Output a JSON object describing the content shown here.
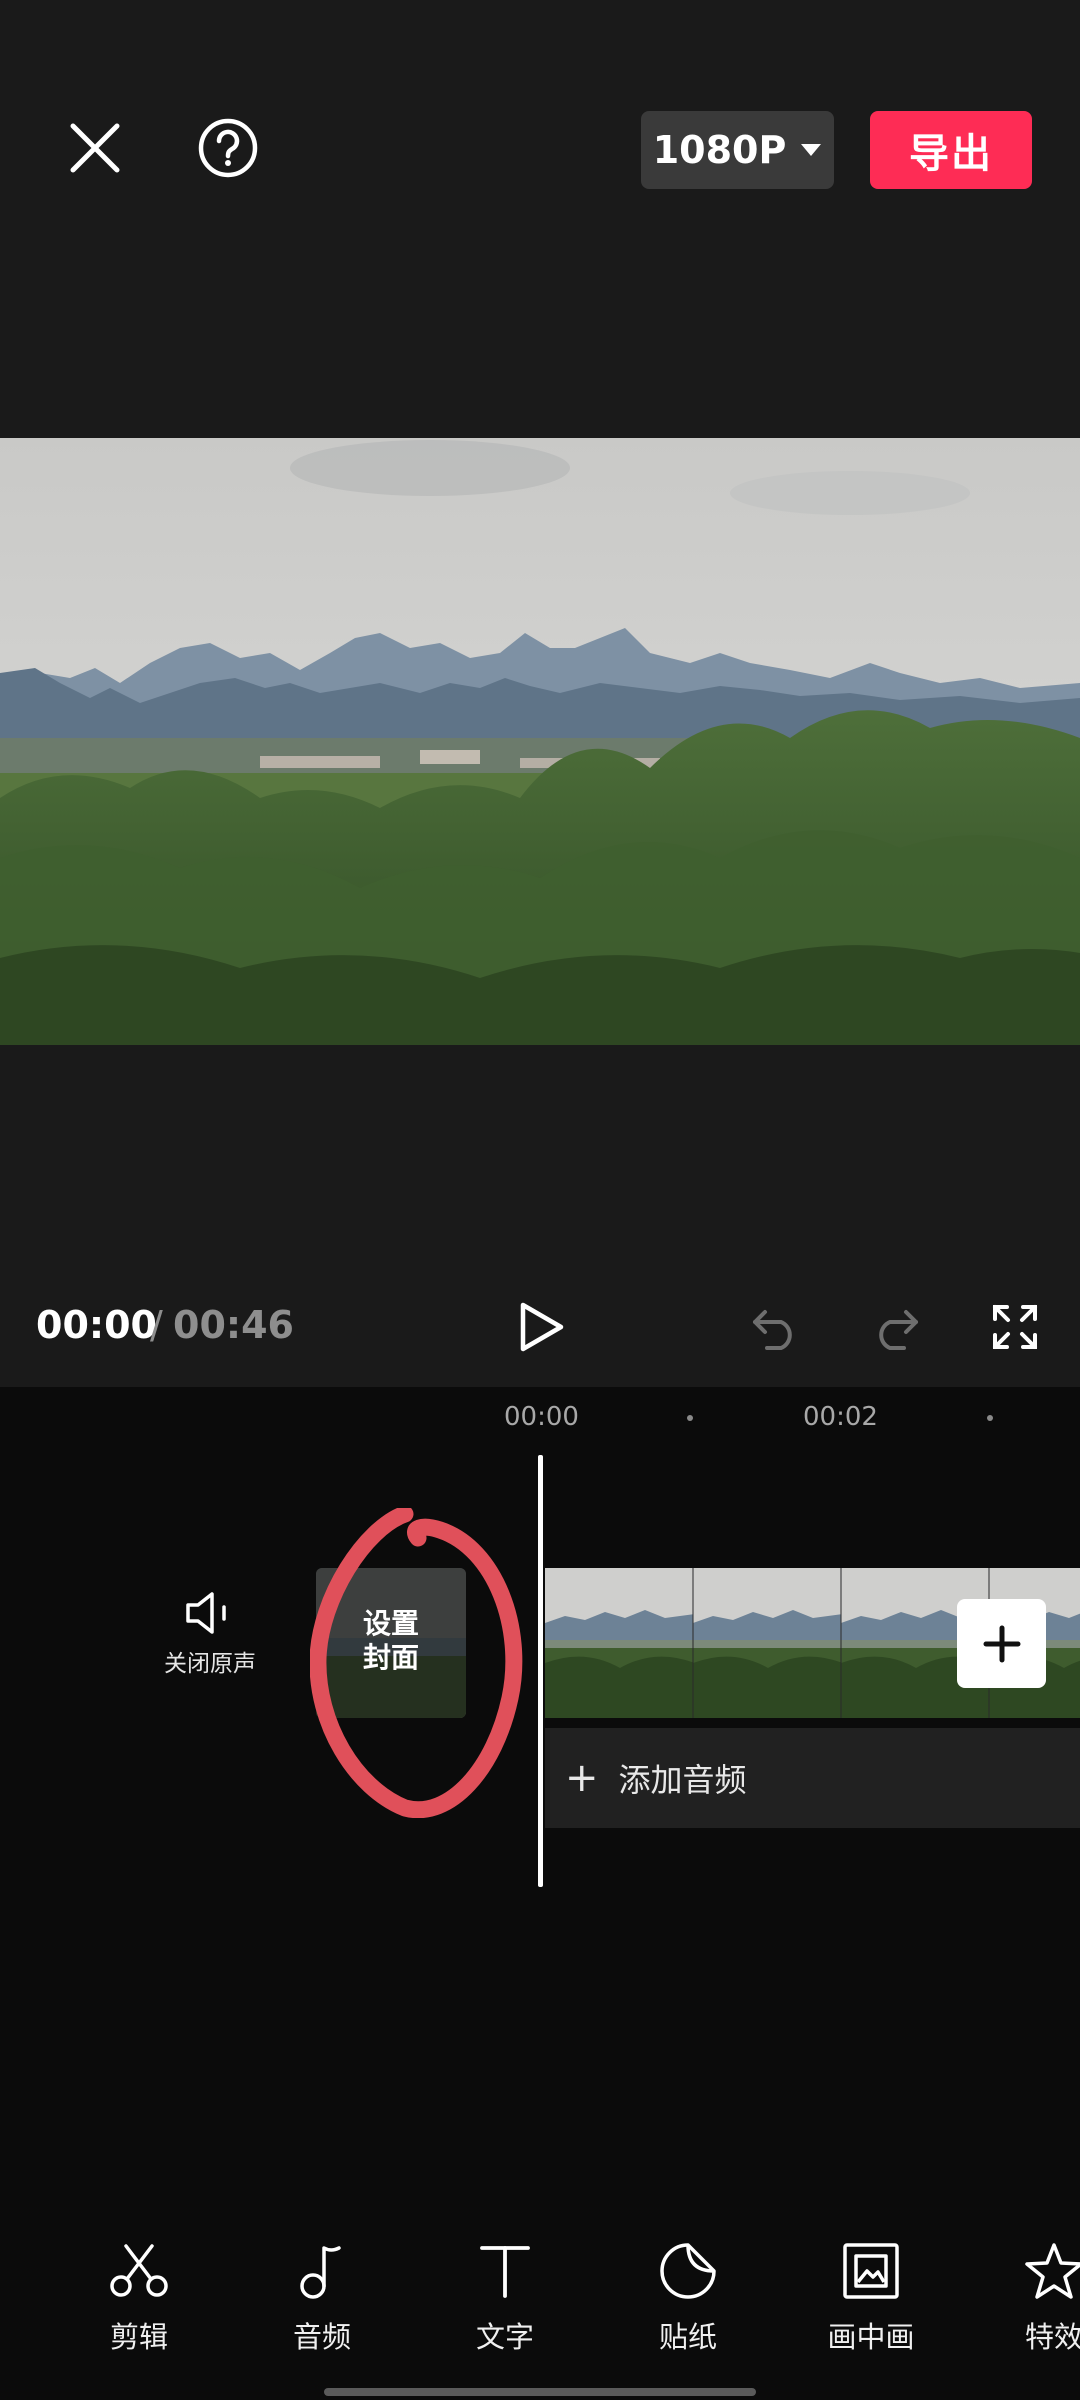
{
  "header": {
    "close_icon": "close-icon",
    "help_icon": "help-icon",
    "resolution": "1080P",
    "export_label": "导出"
  },
  "playback": {
    "current_time": "00:00",
    "separator": "/",
    "total_time": "00:46",
    "play_icon": "play-icon",
    "undo_icon": "undo-icon",
    "redo_icon": "redo-icon",
    "fullscreen_icon": "fullscreen-icon"
  },
  "timeline": {
    "ruler": [
      "00:00",
      "00:02"
    ],
    "mute_label": "关闭原声",
    "cover_label_line1": "设置",
    "cover_label_line2": "封面",
    "add_audio_label": "添加音频",
    "add_audio_plus": "+"
  },
  "toolbar": {
    "items": [
      {
        "label": "剪辑",
        "icon": "scissors-icon"
      },
      {
        "label": "音频",
        "icon": "music-note-icon"
      },
      {
        "label": "文字",
        "icon": "text-icon"
      },
      {
        "label": "贴纸",
        "icon": "sticker-icon"
      },
      {
        "label": "画中画",
        "icon": "picture-in-picture-icon"
      },
      {
        "label": "特效",
        "icon": "star-icon"
      }
    ]
  },
  "colors": {
    "accent": "#fe2c55",
    "background": "#0b0b0b",
    "header_background": "#1a1a1a",
    "annotation_red": "#e0505a"
  }
}
